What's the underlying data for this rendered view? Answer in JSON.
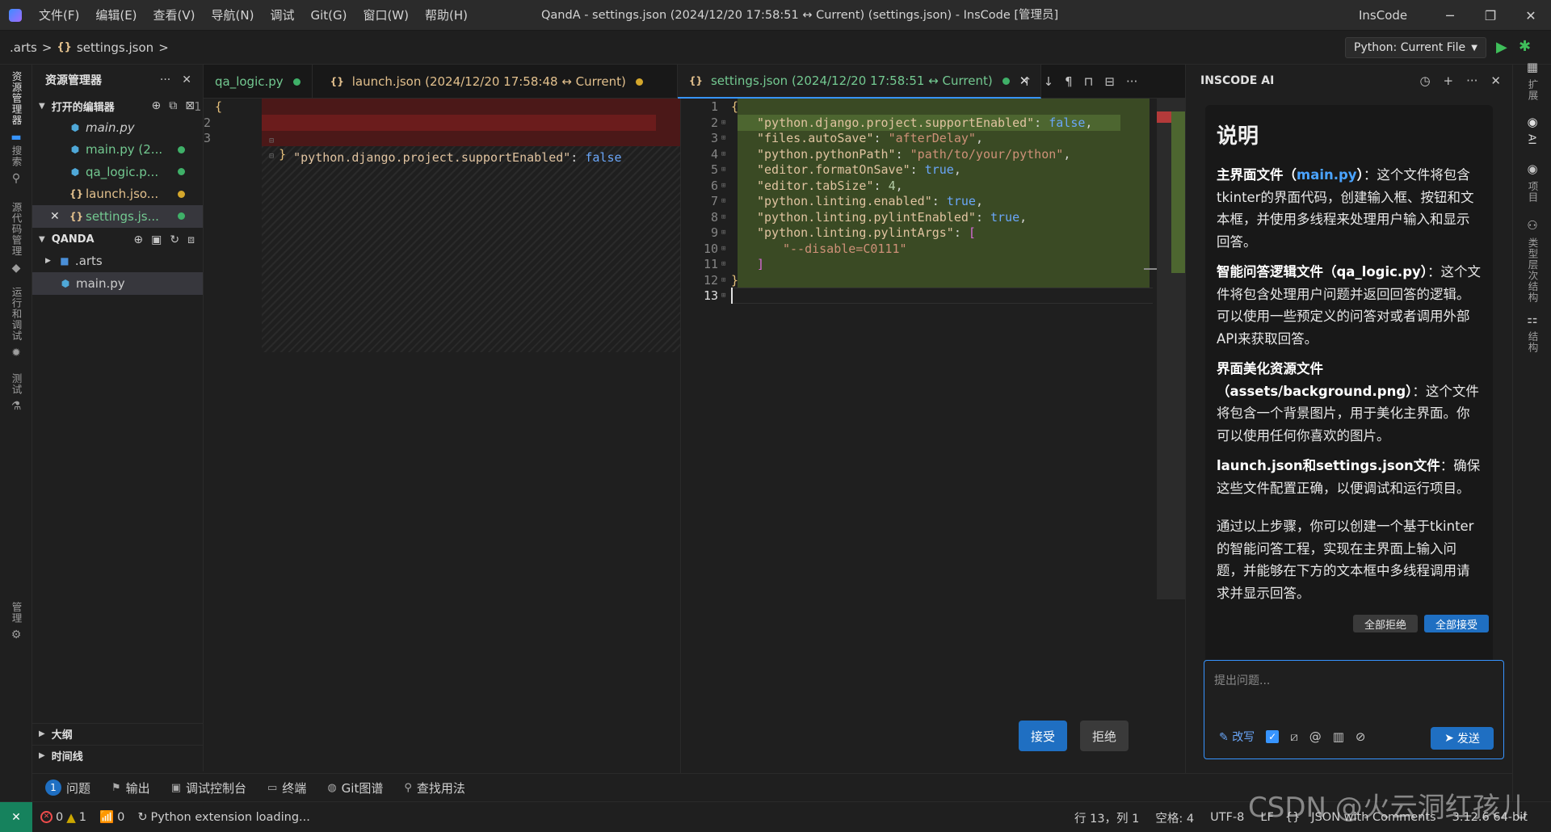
{
  "titlebar": {
    "menus": [
      "文件(F)",
      "编辑(E)",
      "查看(V)",
      "导航(N)",
      "调试",
      "Git(G)",
      "窗口(W)",
      "帮助(H)"
    ],
    "window_title": "QandA - settings.json (2024/12/20 17:58:51 ↔ Current) (settings.json) - InsCode [管理员]",
    "app_name": "InsCode"
  },
  "breadcrumb": {
    "root": ".arts",
    "sep": ">",
    "file": "settings.json",
    "trail": ">"
  },
  "run_config": {
    "label": "Python: Current File"
  },
  "activity_left": {
    "items": [
      "资源管理器",
      "搜索",
      "源代码管理",
      "运行和调试",
      "测试",
      "管理"
    ]
  },
  "explorer": {
    "title": "资源管理器",
    "open_editors_title": "打开的编辑器",
    "open_editors": [
      {
        "name": "main.py",
        "status": ""
      },
      {
        "name": "main.py (2...",
        "status": "modified"
      },
      {
        "name": "qa_logic.p...",
        "status": "modified"
      },
      {
        "name": "launch.jso...",
        "status": "modified"
      },
      {
        "name": "settings.js...",
        "status": "modified"
      }
    ],
    "project_title": "QANDA",
    "folder": ".arts",
    "file": "main.py",
    "outline_title": "大纲",
    "timeline_title": "时间线"
  },
  "tabs": [
    {
      "label": "qa_logic.py"
    },
    {
      "label": "launch.json (2024/12/20 17:58:48 ↔ Current)"
    },
    {
      "label": "settings.json (2024/12/20 17:58:51 ↔ Current)"
    }
  ],
  "diff_left": {
    "line_numbers": [
      "1",
      "2",
      "3"
    ],
    "line1": "{",
    "line2_key": "\"python.django.project.supportEnabled\"",
    "line2_colon": ": ",
    "line2_val": "false",
    "line3": "}"
  },
  "diff_right": {
    "line_numbers": [
      "1",
      "2",
      "3",
      "4",
      "5",
      "6",
      "7",
      "8",
      "9",
      "10",
      "11",
      "12",
      "13"
    ],
    "open_brace": "{",
    "close_brace": "}",
    "lines": [
      {
        "key": "\"python.django.project.supportEnabled\"",
        "val": "false",
        "type": "bool",
        "tail": ","
      },
      {
        "key": "\"files.autoSave\"",
        "val": "\"afterDelay\"",
        "type": "str",
        "tail": ","
      },
      {
        "key": "\"python.pythonPath\"",
        "val": "\"path/to/your/python\"",
        "type": "str",
        "tail": ","
      },
      {
        "key": "\"editor.formatOnSave\"",
        "val": "true",
        "type": "bool",
        "tail": ","
      },
      {
        "key": "\"editor.tabSize\"",
        "val": "4",
        "type": "num",
        "tail": ","
      },
      {
        "key": "\"python.linting.enabled\"",
        "val": "true",
        "type": "bool",
        "tail": ","
      },
      {
        "key": "\"python.linting.pylintEnabled\"",
        "val": "true",
        "type": "bool",
        "tail": ","
      },
      {
        "key": "\"python.linting.pylintArgs\"",
        "val": "[",
        "type": "brk",
        "tail": ""
      }
    ],
    "array_item": "\"--disable=C0111\"",
    "array_close": "]"
  },
  "diff_buttons": {
    "accept": "接受",
    "reject": "拒绝"
  },
  "ai": {
    "title": "INSCODE AI",
    "heading": "说明",
    "p1_bold": "主界面文件（",
    "p1_link": "main.py",
    "p1_bold2": "）",
    "p1_rest": "：这个文件将包含tkinter的界面代码，创建输入框、按钮和文本框，并使用多线程来处理用户输入和显示回答。",
    "p2_bold": "智能问答逻辑文件（qa_logic.py）",
    "p2_rest": "：这个文件将包含处理用户问题并返回回答的逻辑。可以使用一些预定义的问答对或者调用外部API来获取回答。",
    "p3_bold": "界面美化资源文件（assets/background.png）",
    "p3_rest": "：这个文件将包含一个背景图片，用于美化主界面。你可以使用任何你喜欢的图片。",
    "p4_bold": "launch.json和settings.json文件",
    "p4_rest": "：确保这些文件配置正确，以便调试和运行项目。",
    "p5": "通过以上步骤，你可以创建一个基于tkinter的智能问答工程，实现在主界面上输入问题，并能够在下方的文本框中多线程调用请求并显示回答。",
    "reject_all": "全部拒绝",
    "accept_all": "全部接受",
    "input_placeholder": "提出问题...",
    "rewrite": "改写",
    "send": "发送"
  },
  "activity_right": {
    "items": [
      "扩展",
      "AI",
      "项目",
      "类型层次结构",
      "结构"
    ]
  },
  "panel_tabs": [
    {
      "label": "问题",
      "badge": "1"
    },
    {
      "label": "输出"
    },
    {
      "label": "调试控制台"
    },
    {
      "label": "终端"
    },
    {
      "label": "Git图谱"
    },
    {
      "label": "查找用法"
    }
  ],
  "status": {
    "errors": "0",
    "warnings": "1",
    "ports": "0",
    "loading": "Python extension loading...",
    "position": "行 13，列 1",
    "spaces": "空格: 4",
    "encoding": "UTF-8",
    "eol": "LF",
    "language": "JSON with Comments",
    "version": "3.12.6 64-bit"
  },
  "watermark": "CSDN @火云洞红孩儿"
}
